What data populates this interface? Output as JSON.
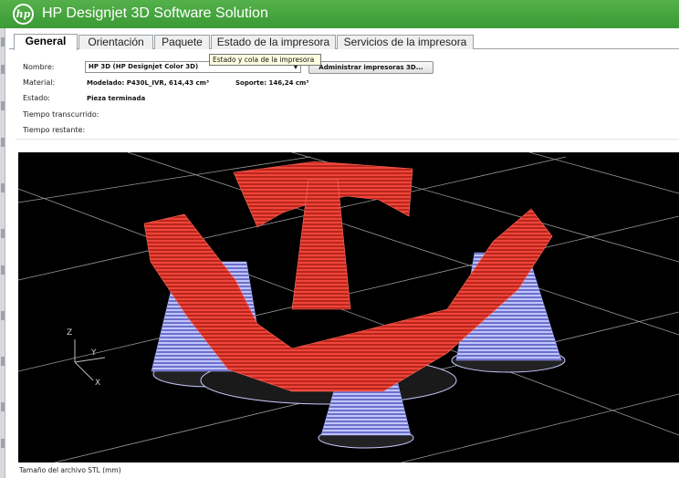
{
  "app": {
    "logo_text": "hp",
    "title": "HP Designjet 3D Software Solution"
  },
  "tabs": [
    {
      "label": "General",
      "active": true
    },
    {
      "label": "Orientación",
      "active": false
    },
    {
      "label": "Paquete",
      "active": false
    },
    {
      "label": "Estado de la impresora",
      "active": false
    },
    {
      "label": "Servicios de la impresora",
      "active": false
    }
  ],
  "tooltip": "Estado y cola de la impresora",
  "form": {
    "nombre_label": "Nombre:",
    "nombre_value": "HP 3D  (HP Designjet Color 3D)",
    "manage_button": "Administrar impresoras 3D...",
    "material_label": "Material:",
    "modelado": "Modelado:  P430L_IVR,  614,43  cm³",
    "soporte": "Soporte:  146,24  cm³",
    "estado_label": "Estado:",
    "estado_value": "Pieza terminada",
    "tiempo_transcurrido_label": "Tiempo transcurrido:",
    "tiempo_restante_label": "Tiempo restante:"
  },
  "viewport": {
    "axis_z": "Z",
    "axis_y": "Y",
    "axis_x": "X"
  },
  "footer": "Tamaño del archivo STL (mm)",
  "colors": {
    "title_bar": "#3fa33a",
    "model": "#e8392c",
    "support": "#a9aef0",
    "viewport_bg": "#000000",
    "grid": "#9a9a9a"
  }
}
